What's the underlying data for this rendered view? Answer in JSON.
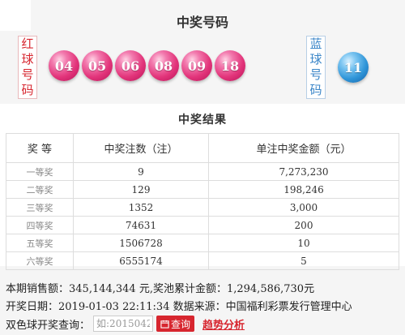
{
  "draw": {
    "title": "中奖号码",
    "red_label": [
      "红",
      "球",
      "号",
      "码"
    ],
    "blue_label": [
      "蓝",
      "球",
      "号",
      "码"
    ],
    "red_balls": [
      "04",
      "05",
      "06",
      "08",
      "09",
      "18"
    ],
    "blue_ball": "11",
    "colors": {
      "red_ball": "#e2347a",
      "blue_ball": "#2f95d8",
      "red_text": "#d7262f",
      "blue_text": "#3b86c8"
    }
  },
  "results": {
    "title": "中奖结果",
    "headers": [
      "奖 等",
      "中奖注数（注）",
      "单注中奖金额（元）"
    ],
    "rows": [
      {
        "level": "一等奖",
        "count": "9",
        "amount": "7,273,230"
      },
      {
        "level": "二等奖",
        "count": "129",
        "amount": "198,246"
      },
      {
        "level": "三等奖",
        "count": "1352",
        "amount": "3,000"
      },
      {
        "level": "四等奖",
        "count": "74631",
        "amount": "200"
      },
      {
        "level": "五等奖",
        "count": "1506728",
        "amount": "10"
      },
      {
        "level": "六等奖",
        "count": "6555174",
        "amount": "5"
      }
    ]
  },
  "info": {
    "sales_line": "本期销售额：345,144,344 元,奖池累计金额：1,294,586,730元",
    "date_line": "开奖日期：2019-01-03 22:11:34 数据来源：中国福利彩票发行管理中心"
  },
  "query": {
    "label": "双色球开奖查询：",
    "placeholder": "如:2015042",
    "button_label": "查询",
    "trend_link": "趋势分析"
  }
}
